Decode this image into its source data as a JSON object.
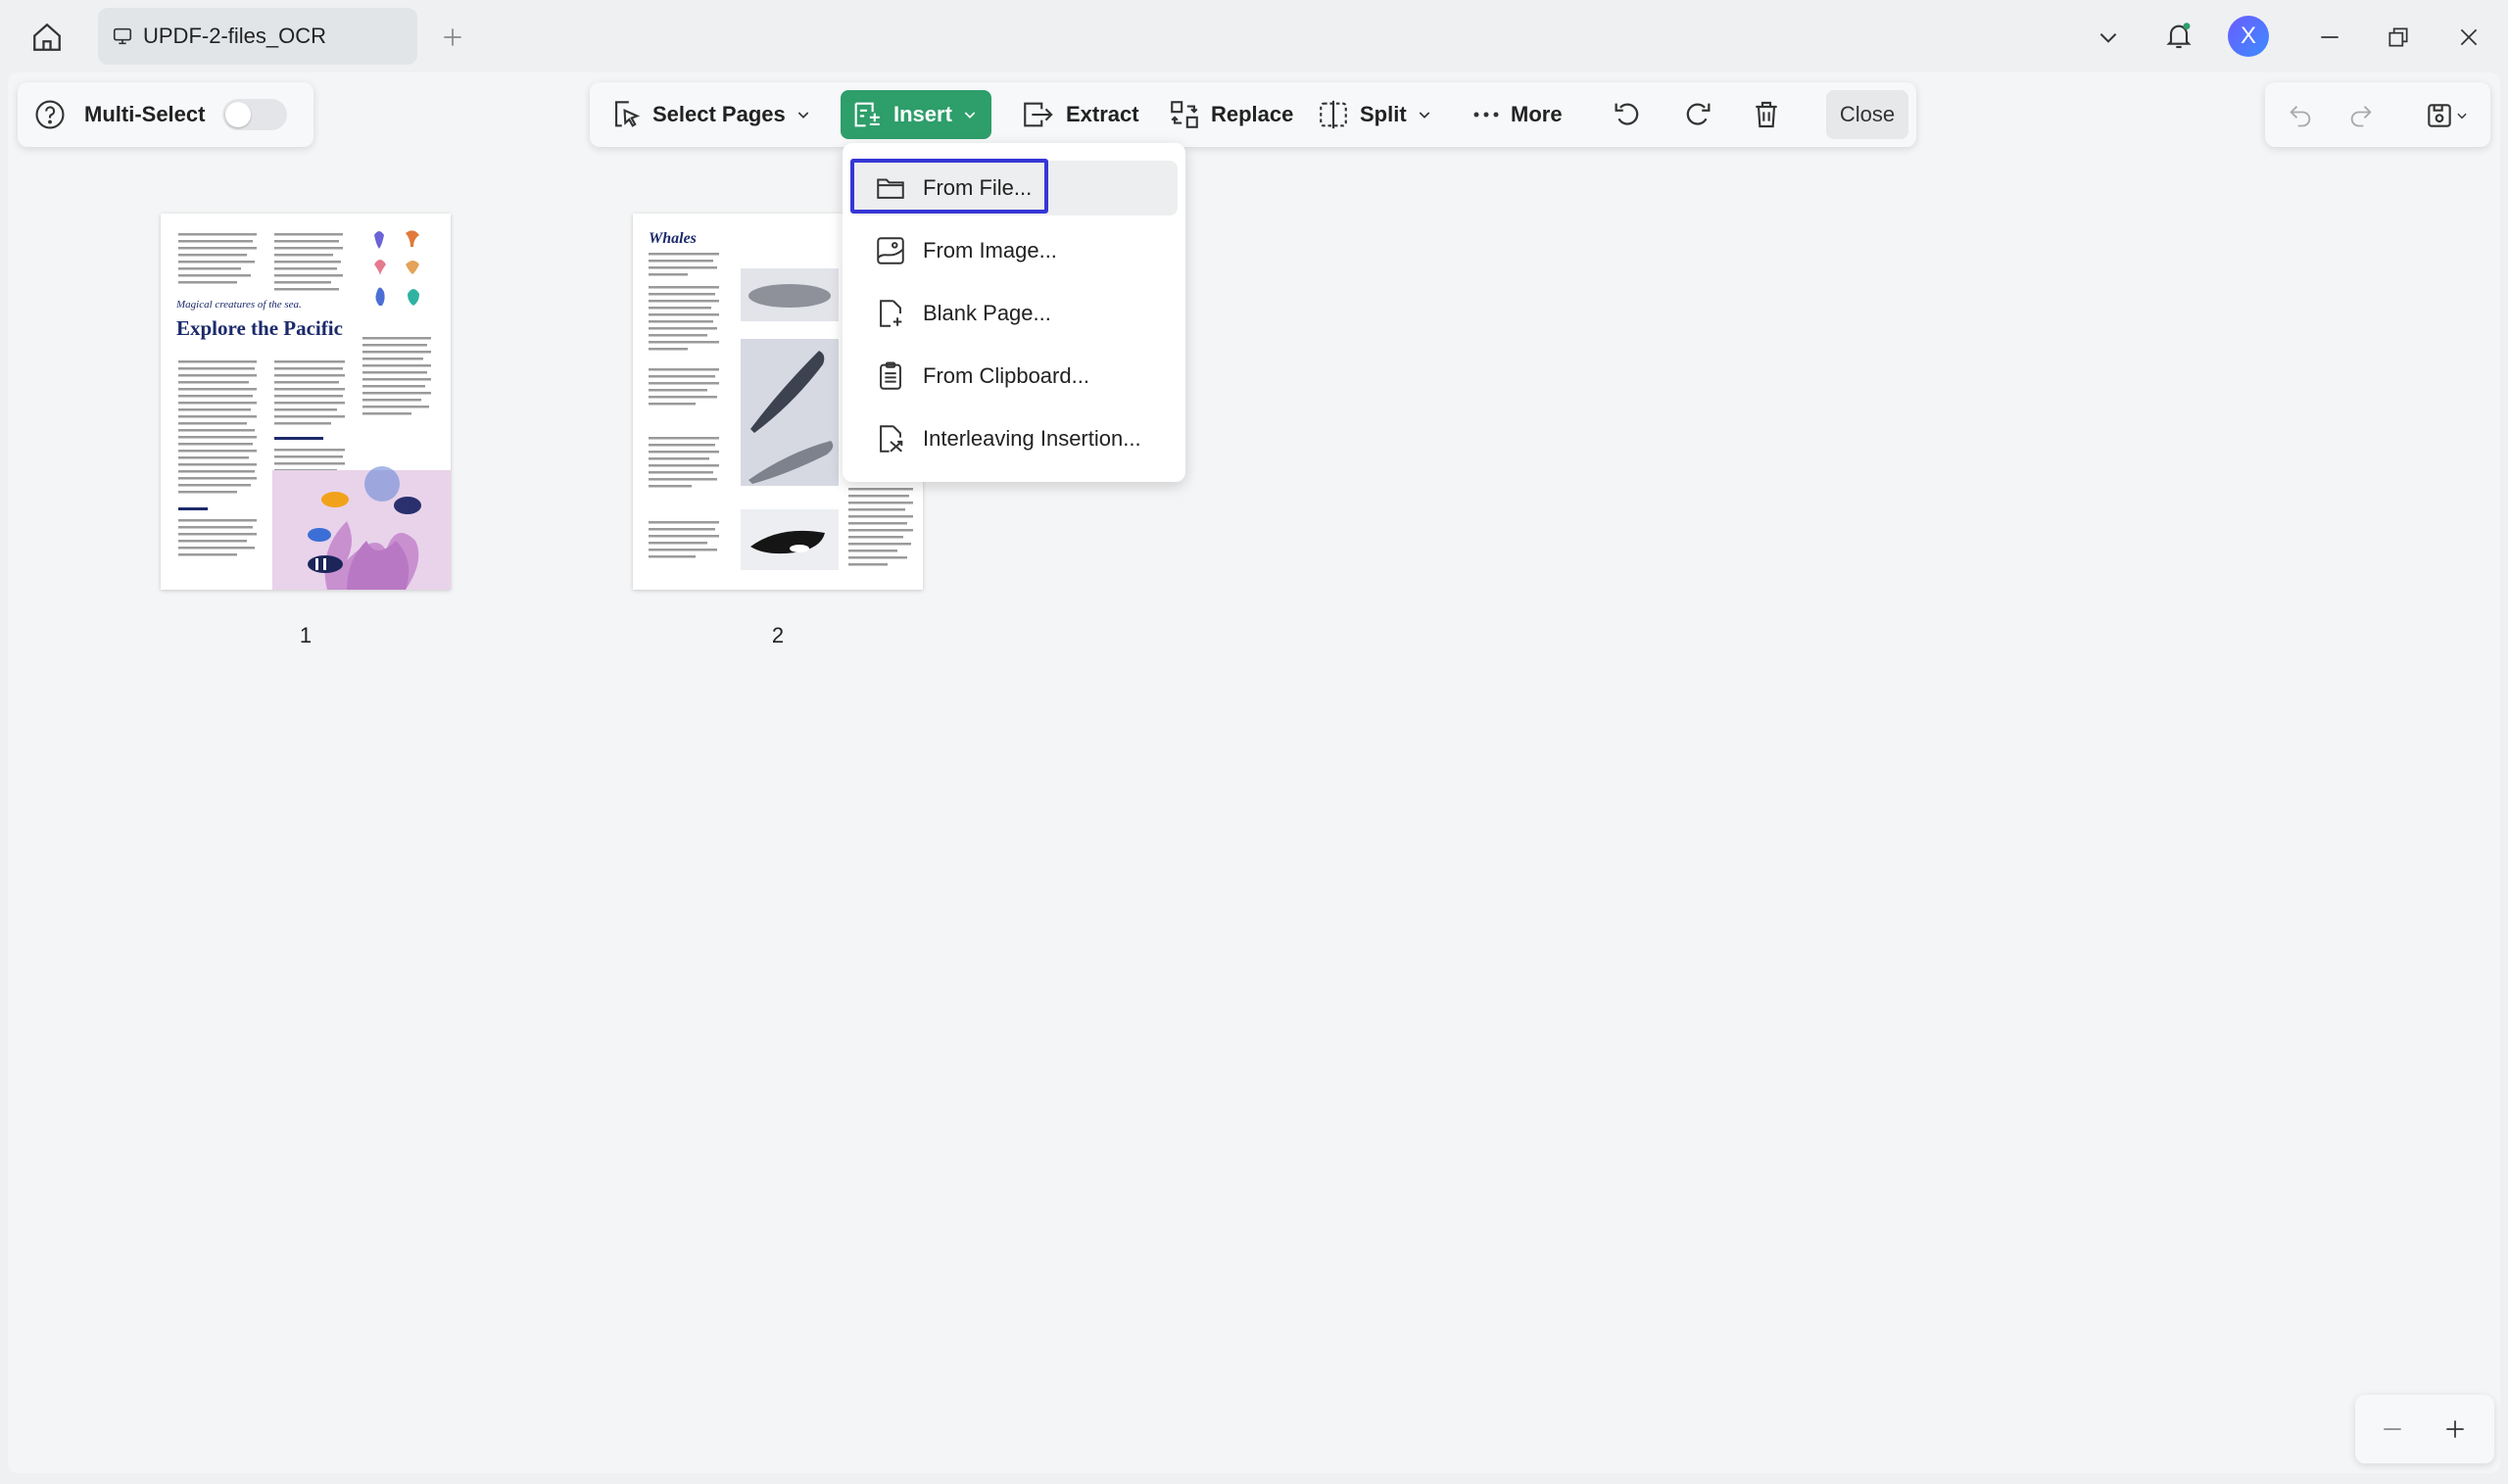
{
  "titlebar": {
    "tab_title": "UPDF-2-files_OCR",
    "avatar_letter": "X"
  },
  "left_panel": {
    "multi_select_label": "Multi-Select",
    "multi_select_on": false
  },
  "toolbar": {
    "select_pages": "Select Pages",
    "insert": "Insert",
    "extract": "Extract",
    "replace": "Replace",
    "split": "Split",
    "more": "More",
    "close": "Close",
    "accent_color": "#2e9e6a"
  },
  "insert_menu": {
    "items": [
      {
        "label": "From File...",
        "icon": "folder-icon"
      },
      {
        "label": "From Image...",
        "icon": "image-icon"
      },
      {
        "label": "Blank Page...",
        "icon": "blank-page-icon"
      },
      {
        "label": "From Clipboard...",
        "icon": "clipboard-icon"
      },
      {
        "label": "Interleaving Insertion...",
        "icon": "interleave-icon"
      }
    ],
    "focused_index": 0
  },
  "pages": [
    {
      "number": "1",
      "subtitle": "Magical creatures of the sea.",
      "title": "Explore the Pacific"
    },
    {
      "number": "2",
      "title": "Whales"
    }
  ]
}
